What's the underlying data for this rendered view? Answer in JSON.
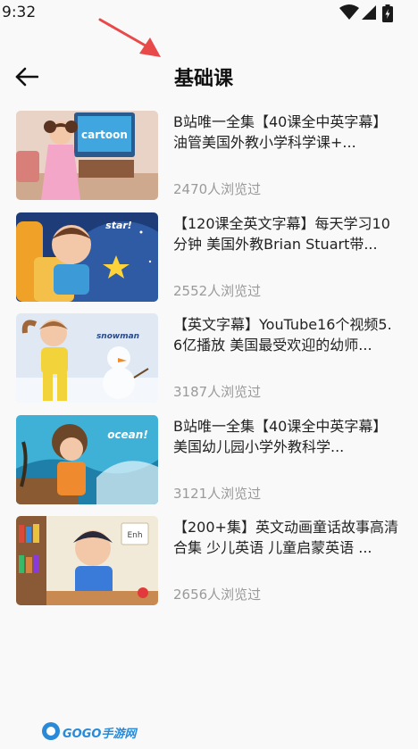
{
  "status_bar": {
    "time": "9:32"
  },
  "header": {
    "title": "基础课"
  },
  "courses": [
    {
      "title": "B站唯一全集【40课全中英字幕】油管美国外教小学科学课+...",
      "views": "2470人浏览过",
      "thumb_text": "cartoon"
    },
    {
      "title": "【120课全英文字幕】每天学习10分钟 美国外教Brian Stuart带...",
      "views": "2552人浏览过",
      "thumb_text": "star!"
    },
    {
      "title": "【英文字幕】YouTube16个视频5.6亿播放 美国最受欢迎的幼师...",
      "views": "3187人浏览过",
      "thumb_text": "snowman"
    },
    {
      "title": "B站唯一全集【40课全中英字幕】美国幼儿园小学外教科学...",
      "views": "3121人浏览过",
      "thumb_text": "ocean!"
    },
    {
      "title": "【200+集】英文动画童话故事高清合集 少儿英语 儿童启蒙英语 ...",
      "views": "2656人浏览过",
      "thumb_text": "Enh"
    }
  ],
  "watermark": {
    "text": "GOGO手游网"
  },
  "colors": {
    "background": "#f9f9f9",
    "annotation_arrow": "#e84a4a",
    "views_text": "#9a9a9a"
  }
}
